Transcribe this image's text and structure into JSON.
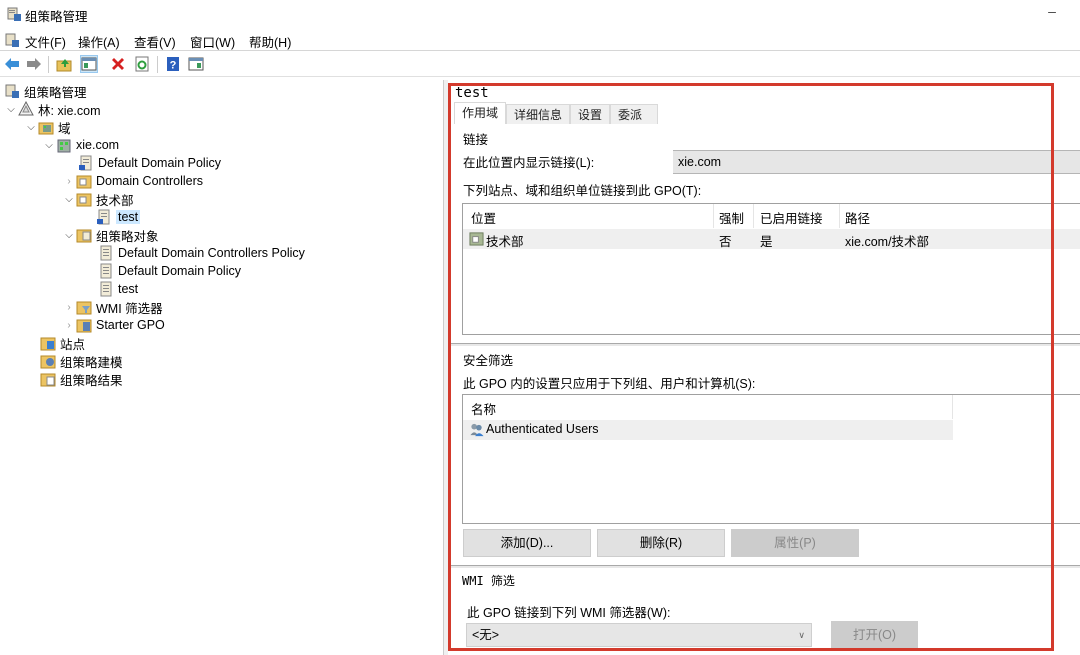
{
  "window": {
    "title": "组策略管理",
    "minimize": "–"
  },
  "menu": [
    {
      "label": "文件(F)"
    },
    {
      "label": "操作(A)"
    },
    {
      "label": "查看(V)"
    },
    {
      "label": "窗口(W)"
    },
    {
      "label": "帮助(H)"
    }
  ],
  "toolbar": {
    "buttons": [
      "back-icon",
      "forward-icon",
      "up-folder-icon",
      "show-hide-tree-icon",
      "delete-icon",
      "refresh-icon",
      "help-icon",
      "action-pane-icon"
    ]
  },
  "tree": {
    "root": "组策略管理",
    "forest": "林: xie.com",
    "domains": "域",
    "domain": "xie.com",
    "default_domain_policy": "Default Domain Policy",
    "domain_controllers": "Domain Controllers",
    "ou": "技术部",
    "ou_link": "test",
    "gpo_container": "组策略对象",
    "gpo_items": [
      "Default Domain Controllers Policy",
      "Default Domain Policy",
      "test"
    ],
    "wmi_filters": "WMI 筛选器",
    "starter_gpo": "Starter GPO",
    "sites": "站点",
    "modeling": "组策略建模",
    "results": "组策略结果"
  },
  "detail": {
    "title": "test",
    "tabs": [
      "作用域",
      "详细信息",
      "设置",
      "委派"
    ],
    "active_tab": "作用域",
    "links_heading": "链接",
    "display_links_label": "在此位置内显示链接(L):",
    "display_links_value": "xie.com",
    "linked_label": "下列站点、域和组织单位链接到此 GPO(T):",
    "links_table": {
      "columns": [
        "位置",
        "强制",
        "已启用链接",
        "路径"
      ],
      "rows": [
        {
          "location": "技术部",
          "enforced": "否",
          "enabled": "是",
          "path": "xie.com/技术部"
        }
      ]
    },
    "security_heading": "安全筛选",
    "security_label": "此 GPO 内的设置只应用于下列组、用户和计算机(S):",
    "security_table": {
      "columns": [
        "名称"
      ],
      "rows": [
        {
          "name": "Authenticated Users"
        }
      ]
    },
    "buttons": {
      "add": "添加(D)...",
      "remove": "删除(R)",
      "properties": "属性(P)"
    },
    "wmi_heading": "WMI 筛选",
    "wmi_label": "此 GPO 链接到下列 WMI 筛选器(W):",
    "wmi_value": "<无>",
    "wmi_open": "打开(O)"
  },
  "colors": {
    "highlight_box": "#d33a2c",
    "selection": "#cce8ff"
  }
}
